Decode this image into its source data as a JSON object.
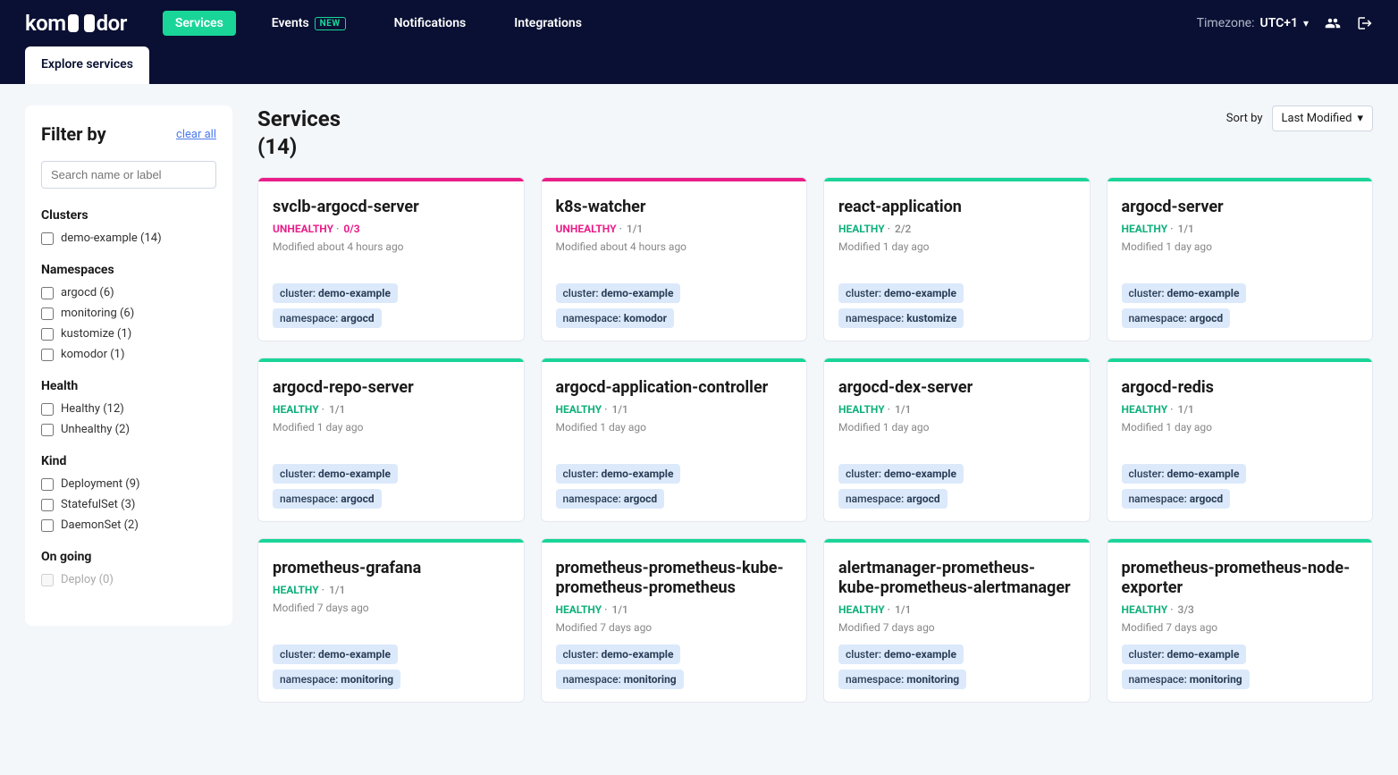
{
  "brand": "komodor",
  "nav": {
    "services": "Services",
    "events": "Events",
    "events_badge": "NEW",
    "notifications": "Notifications",
    "integrations": "Integrations"
  },
  "top": {
    "tz_label": "Timezone:",
    "tz_value": "UTC+1"
  },
  "subtab": "Explore services",
  "filter": {
    "title": "Filter by",
    "clear": "clear all",
    "search_placeholder": "Search name or label",
    "groups": [
      {
        "title": "Clusters",
        "items": [
          {
            "label": "demo-example (14)"
          }
        ]
      },
      {
        "title": "Namespaces",
        "items": [
          {
            "label": "argocd (6)"
          },
          {
            "label": "monitoring (6)"
          },
          {
            "label": "kustomize (1)"
          },
          {
            "label": "komodor (1)"
          }
        ]
      },
      {
        "title": "Health",
        "items": [
          {
            "label": "Healthy (12)"
          },
          {
            "label": "Unhealthy (2)"
          }
        ]
      },
      {
        "title": "Kind",
        "items": [
          {
            "label": "Deployment (9)"
          },
          {
            "label": "StatefulSet (3)"
          },
          {
            "label": "DaemonSet (2)"
          }
        ]
      },
      {
        "title": "On going",
        "items": [
          {
            "label": "Deploy (0)",
            "disabled": true
          }
        ]
      }
    ]
  },
  "content": {
    "title": "Services",
    "count": "(14)",
    "sort_label": "Sort by",
    "sort_value": "Last Modified"
  },
  "cards": [
    {
      "name": "svclb-argocd-server",
      "status": "UNHEALTHY",
      "status_class": "unhealthy",
      "count": "0/3",
      "count_bad": true,
      "modified": "Modified about 4 hours ago",
      "cluster": "demo-example",
      "namespace": "argocd"
    },
    {
      "name": "k8s-watcher",
      "status": "UNHEALTHY",
      "status_class": "unhealthy",
      "count": "1/1",
      "modified": "Modified about 4 hours ago",
      "cluster": "demo-example",
      "namespace": "komodor"
    },
    {
      "name": "react-application",
      "status": "HEALTHY",
      "status_class": "healthy",
      "count": "2/2",
      "modified": "Modified 1 day ago",
      "cluster": "demo-example",
      "namespace": "kustomize"
    },
    {
      "name": "argocd-server",
      "status": "HEALTHY",
      "status_class": "healthy",
      "count": "1/1",
      "modified": "Modified 1 day ago",
      "cluster": "demo-example",
      "namespace": "argocd"
    },
    {
      "name": "argocd-repo-server",
      "status": "HEALTHY",
      "status_class": "healthy",
      "count": "1/1",
      "modified": "Modified 1 day ago",
      "cluster": "demo-example",
      "namespace": "argocd"
    },
    {
      "name": "argocd-application-controller",
      "status": "HEALTHY",
      "status_class": "healthy",
      "count": "1/1",
      "modified": "Modified 1 day ago",
      "cluster": "demo-example",
      "namespace": "argocd"
    },
    {
      "name": "argocd-dex-server",
      "status": "HEALTHY",
      "status_class": "healthy",
      "count": "1/1",
      "modified": "Modified 1 day ago",
      "cluster": "demo-example",
      "namespace": "argocd"
    },
    {
      "name": "argocd-redis",
      "status": "HEALTHY",
      "status_class": "healthy",
      "count": "1/1",
      "modified": "Modified 1 day ago",
      "cluster": "demo-example",
      "namespace": "argocd"
    },
    {
      "name": "prometheus-grafana",
      "status": "HEALTHY",
      "status_class": "healthy",
      "count": "1/1",
      "modified": "Modified 7 days ago",
      "cluster": "demo-example",
      "namespace": "monitoring"
    },
    {
      "name": "prometheus-prometheus-kube-prometheus-prometheus",
      "status": "HEALTHY",
      "status_class": "healthy",
      "count": "1/1",
      "modified": "Modified 7 days ago",
      "cluster": "demo-example",
      "namespace": "monitoring"
    },
    {
      "name": "alertmanager-prometheus-kube-prometheus-alertmanager",
      "status": "HEALTHY",
      "status_class": "healthy",
      "count": "1/1",
      "modified": "Modified 7 days ago",
      "cluster": "demo-example",
      "namespace": "monitoring"
    },
    {
      "name": "prometheus-prometheus-node-exporter",
      "status": "HEALTHY",
      "status_class": "healthy",
      "count": "3/3",
      "modified": "Modified 7 days ago",
      "cluster": "demo-example",
      "namespace": "monitoring"
    }
  ]
}
